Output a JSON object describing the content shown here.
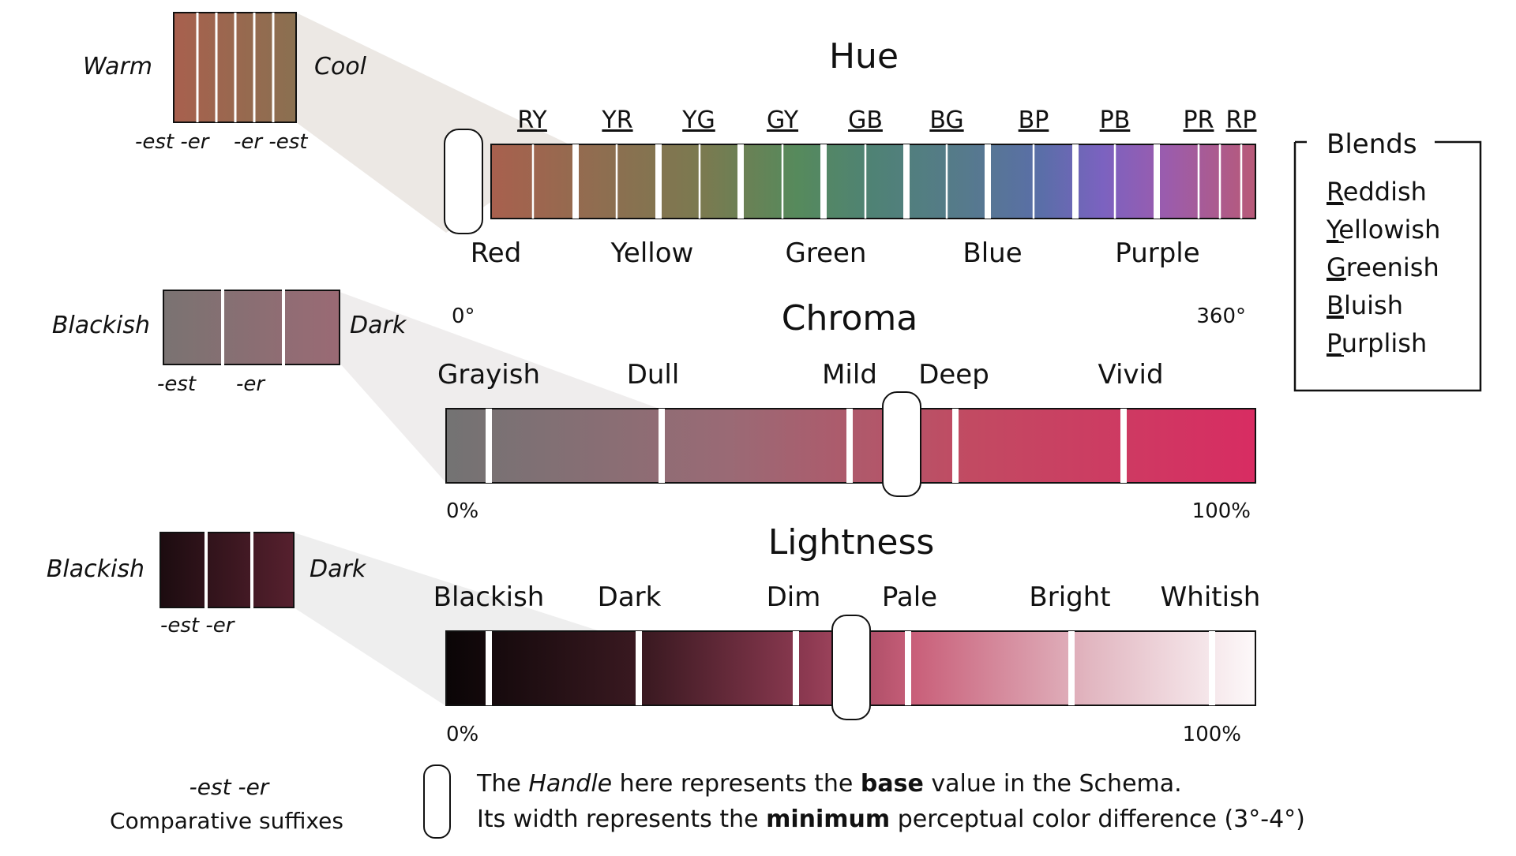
{
  "hue": {
    "title": "Hue",
    "blend_codes": [
      "RY",
      "YR",
      "YG",
      "GY",
      "GB",
      "BG",
      "BP",
      "PB",
      "PR",
      "RP"
    ],
    "base_names": [
      "Red",
      "Yellow",
      "Green",
      "Blue",
      "Purple"
    ],
    "range_start": "0°",
    "range_end": "360°",
    "inset": {
      "left_label": "Warm",
      "right_label": "Cool",
      "suffix_left": "-est -er",
      "suffix_right": "-er -est"
    },
    "handle_position_fraction": 0.0
  },
  "chroma": {
    "title": "Chroma",
    "terms": [
      "Grayish",
      "Dull",
      "Mild",
      "Deep",
      "Vivid"
    ],
    "range_start": "0%",
    "range_end": "100%",
    "inset": {
      "left_label": "Blackish",
      "right_label": "Dark",
      "suffix_left": "-est",
      "suffix_right": "-er"
    },
    "handle_position_fraction": 0.565
  },
  "lightness": {
    "title": "Lightness",
    "terms": [
      "Blackish",
      "Dark",
      "Dim",
      "Pale",
      "Bright",
      "Whitish"
    ],
    "range_start": "0%",
    "range_end": "100%",
    "inset": {
      "left_label": "Blackish",
      "right_label": "Dark",
      "suffix": "-est -er"
    },
    "handle_position_fraction": 0.5
  },
  "blends": {
    "title": "Blends",
    "items": [
      {
        "initial": "R",
        "rest": "eddish"
      },
      {
        "initial": "Y",
        "rest": "ellowish"
      },
      {
        "initial": "G",
        "rest": "reenish"
      },
      {
        "initial": "B",
        "rest": "luish"
      },
      {
        "initial": "P",
        "rest": "urplish"
      }
    ]
  },
  "suffix_legend": {
    "suffixes": "-est -er",
    "caption": "Comparative suffixes"
  },
  "handle_note": {
    "line1_pre": "The ",
    "line1_handle": "Handle",
    "line1_mid": " here represents the ",
    "line1_base": "base",
    "line1_post": " value in the Schema.",
    "line2_pre": "Its width represents the ",
    "line2_min": "minimum",
    "line2_post": " perceptual color difference (3°-4°)"
  },
  "colors": {
    "red": "#a8604e",
    "yellow": "#7c7a4e",
    "green": "#4f8a5e",
    "blue": "#5a6fa8",
    "purple": "#8e5eb8",
    "chroma_gray": "#737373",
    "chroma_vivid": "#d82c62",
    "black": "#0a0506",
    "white": "#fdf9fa"
  }
}
